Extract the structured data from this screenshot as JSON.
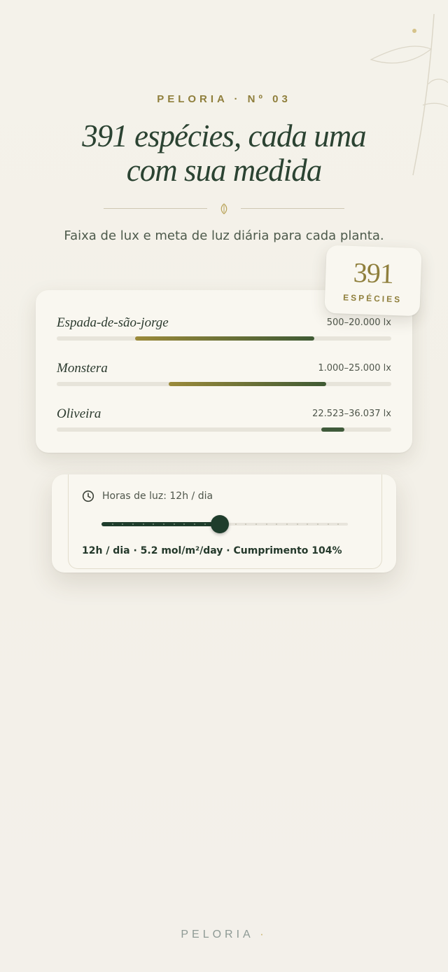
{
  "header": {
    "eyebrow": "PELORIA · Nº 03",
    "title_line1": "391 espécies, cada uma",
    "title_line2": "com sua medida",
    "subtitle": "Faixa de lux e meta de luz diária para cada planta."
  },
  "badge": {
    "number": "391",
    "label": "ESPÉCIES"
  },
  "plants": [
    {
      "name": "Espada-de-são-jorge",
      "range": "500–20.000 lx",
      "start": 0.235,
      "end": 0.77,
      "colors": [
        "#9b8a3a",
        "#3f5a34"
      ]
    },
    {
      "name": "Monstera",
      "range": "1.000–25.000 lx",
      "start": 0.335,
      "end": 0.805,
      "colors": [
        "#9b8a3a",
        "#3f5a34"
      ]
    },
    {
      "name": "Oliveira",
      "range": "22.523–36.037 lx",
      "start": 0.79,
      "end": 0.86,
      "colors": [
        "#3f5a3a",
        "#3f5a3a"
      ]
    }
  ],
  "light_panel": {
    "label": "Horas de luz: 12h / dia",
    "slider_value": 0.48,
    "summary": "12h / dia · 5.2 mol/m²/day · Cumprimento 104%"
  },
  "footer": {
    "brand": "PELORIA",
    "dot": "·"
  },
  "colors": {
    "accent": "#8f7f3c",
    "dark_green": "#1f3d2c",
    "background": "#f4f2ea"
  }
}
